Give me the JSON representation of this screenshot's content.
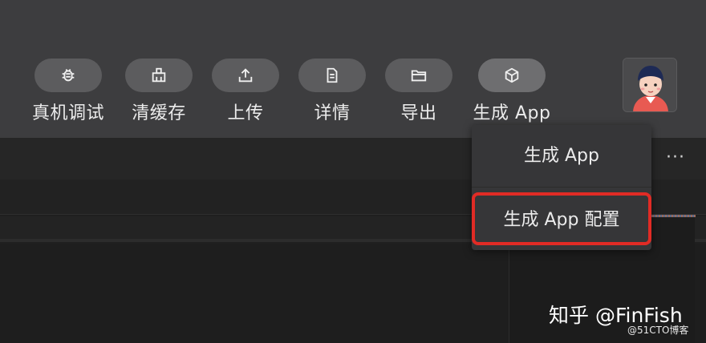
{
  "toolbar": {
    "items": [
      {
        "label": "真机调试",
        "icon": "bug-icon"
      },
      {
        "label": "清缓存",
        "icon": "broom-icon"
      },
      {
        "label": "上传",
        "icon": "upload-icon"
      },
      {
        "label": "详情",
        "icon": "document-icon"
      },
      {
        "label": "导出",
        "icon": "folder-icon"
      },
      {
        "label": "生成 App",
        "icon": "cube-icon"
      }
    ]
  },
  "more_label": "···",
  "dropdown": {
    "items": [
      "生成 App",
      "生成 App 配置"
    ],
    "highlight_color": "#e12b25"
  },
  "watermark": {
    "main": "知乎 @FinFish",
    "sub": "@51CTO博客"
  }
}
